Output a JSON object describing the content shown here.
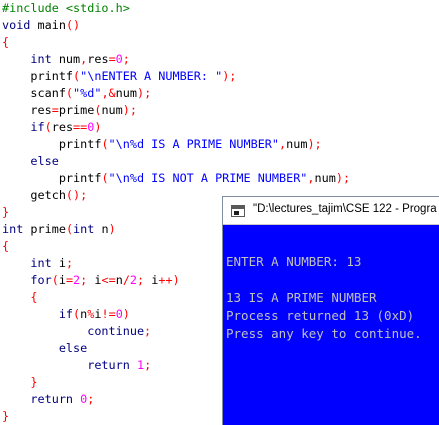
{
  "editor": {
    "lines": [
      [
        [
          "pre",
          "#include <stdio.h>"
        ]
      ],
      [
        [
          "kw",
          "void"
        ],
        [
          "id",
          " main"
        ],
        [
          "op",
          "()"
        ]
      ],
      [
        [
          "op",
          "{"
        ]
      ],
      [
        [
          "kw",
          "    int"
        ],
        [
          "id",
          " num"
        ],
        [
          "op",
          ","
        ],
        [
          "id",
          "res"
        ],
        [
          "op",
          "="
        ],
        [
          "num",
          "0"
        ],
        [
          "op",
          ";"
        ]
      ],
      [
        [
          "id",
          "    printf"
        ],
        [
          "op",
          "("
        ],
        [
          "str",
          "\"\\nENTER A NUMBER: \""
        ],
        [
          "op",
          ");"
        ]
      ],
      [
        [
          "id",
          "    scanf"
        ],
        [
          "op",
          "("
        ],
        [
          "str",
          "\"%d\""
        ],
        [
          "op",
          ",&"
        ],
        [
          "id",
          "num"
        ],
        [
          "op",
          ");"
        ]
      ],
      [
        [
          "id",
          "    res"
        ],
        [
          "op",
          "="
        ],
        [
          "id",
          "prime"
        ],
        [
          "op",
          "("
        ],
        [
          "id",
          "num"
        ],
        [
          "op",
          ");"
        ]
      ],
      [
        [
          "kw",
          "    if"
        ],
        [
          "op",
          "("
        ],
        [
          "id",
          "res"
        ],
        [
          "op",
          "=="
        ],
        [
          "num",
          "0"
        ],
        [
          "op",
          ")"
        ]
      ],
      [
        [
          "id",
          "        printf"
        ],
        [
          "op",
          "("
        ],
        [
          "str",
          "\"\\n%d IS A PRIME NUMBER\""
        ],
        [
          "op",
          ","
        ],
        [
          "id",
          "num"
        ],
        [
          "op",
          ");"
        ]
      ],
      [
        [
          "kw",
          "    else"
        ]
      ],
      [
        [
          "id",
          "        printf"
        ],
        [
          "op",
          "("
        ],
        [
          "str",
          "\"\\n%d IS NOT A PRIME NUMBER\""
        ],
        [
          "op",
          ","
        ],
        [
          "id",
          "num"
        ],
        [
          "op",
          ");"
        ]
      ],
      [
        [
          "id",
          "    getch"
        ],
        [
          "op",
          "();"
        ]
      ],
      [
        [
          "op",
          "}"
        ]
      ],
      [
        [
          "kw",
          "int"
        ],
        [
          "id",
          " prime"
        ],
        [
          "op",
          "("
        ],
        [
          "kw",
          "int"
        ],
        [
          "id",
          " n"
        ],
        [
          "op",
          ")"
        ]
      ],
      [
        [
          "op",
          "{"
        ]
      ],
      [
        [
          "kw",
          "    int"
        ],
        [
          "id",
          " i"
        ],
        [
          "op",
          ";"
        ]
      ],
      [
        [
          "kw",
          "    for"
        ],
        [
          "op",
          "("
        ],
        [
          "id",
          "i"
        ],
        [
          "op",
          "="
        ],
        [
          "num",
          "2"
        ],
        [
          "op",
          ";"
        ],
        [
          "id",
          " i"
        ],
        [
          "op",
          "<="
        ],
        [
          "id",
          "n"
        ],
        [
          "op",
          "/"
        ],
        [
          "num",
          "2"
        ],
        [
          "op",
          ";"
        ],
        [
          "id",
          " i"
        ],
        [
          "op",
          "++)"
        ]
      ],
      [
        [
          "op",
          "    {"
        ]
      ],
      [
        [
          "kw",
          "        if"
        ],
        [
          "op",
          "("
        ],
        [
          "id",
          "n"
        ],
        [
          "op",
          "%"
        ],
        [
          "id",
          "i"
        ],
        [
          "op",
          "!="
        ],
        [
          "num",
          "0"
        ],
        [
          "op",
          ")"
        ]
      ],
      [
        [
          "kw",
          "            continue"
        ],
        [
          "op",
          ";"
        ]
      ],
      [
        [
          "kw",
          "        else"
        ]
      ],
      [
        [
          "kw",
          "            return"
        ],
        [
          "num",
          " 1"
        ],
        [
          "op",
          ";"
        ]
      ],
      [
        [
          "op",
          "    }"
        ]
      ],
      [
        [
          "kw",
          "    return"
        ],
        [
          "num",
          " 0"
        ],
        [
          "op",
          ";"
        ]
      ],
      [
        [
          "op",
          "}"
        ]
      ]
    ]
  },
  "console": {
    "title": "\"D:\\lectures_tajim\\CSE 122 - Progra",
    "lines": [
      "",
      "ENTER A NUMBER: 13",
      "",
      "13 IS A PRIME NUMBER",
      "Process returned 13 (0xD)",
      "Press any key to continue."
    ]
  },
  "colors": {
    "preprocessor": "#008000",
    "keyword": "#000080",
    "operator": "#ff0000",
    "string": "#0000ff",
    "number": "#ff00ff",
    "console_background": "#0000ff",
    "console_text": "#c0c0c0"
  },
  "icons": {
    "console_window": "console-window-icon"
  }
}
